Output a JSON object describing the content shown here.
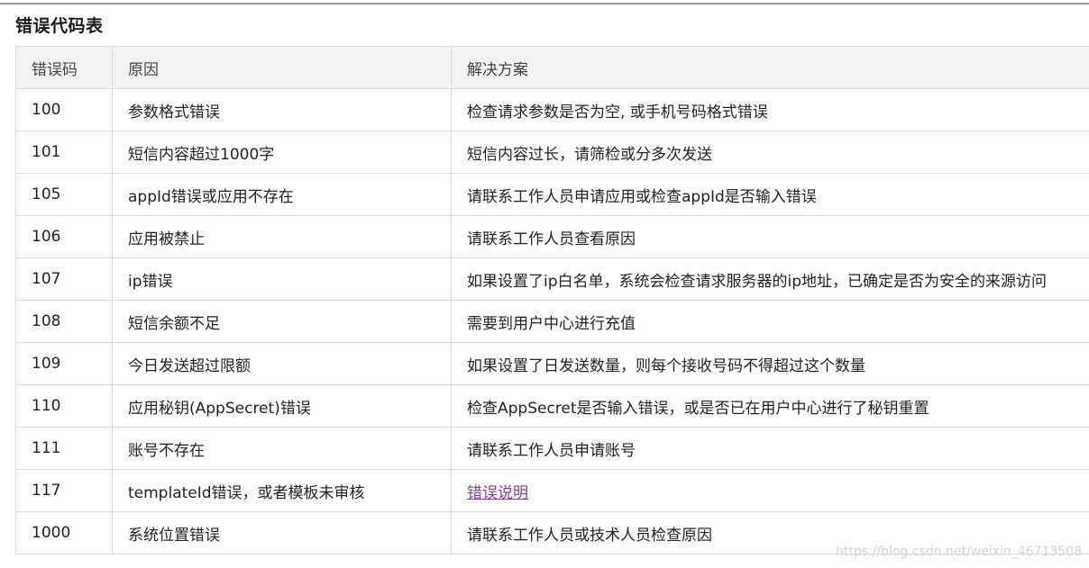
{
  "section_title": "错误代码表",
  "headers": [
    "错误码",
    "原因",
    "解决方案"
  ],
  "rows": [
    {
      "code": "100",
      "reason": "参数格式错误",
      "solution": "检查请求参数是否为空, 或手机号码格式错误"
    },
    {
      "code": "101",
      "reason": "短信内容超过1000字",
      "solution": "短信内容过长，请筛检或分多次发送"
    },
    {
      "code": "105",
      "reason": "appId错误或应用不存在",
      "solution": "请联系工作人员申请应用或检查appId是否输入错误"
    },
    {
      "code": "106",
      "reason": "应用被禁止",
      "solution": "请联系工作人员查看原因"
    },
    {
      "code": "107",
      "reason": "ip错误",
      "solution": "如果设置了ip白名单，系统会检查请求服务器的ip地址，已确定是否为安全的来源访问"
    },
    {
      "code": "108",
      "reason": "短信余额不足",
      "solution": "需要到用户中心进行充值"
    },
    {
      "code": "109",
      "reason": "今日发送超过限额",
      "solution": "如果设置了日发送数量，则每个接收号码不得超过这个数量"
    },
    {
      "code": "110",
      "reason": "应用秘钥(AppSecret)错误",
      "solution": "检查AppSecret是否输入错误，或是否已在用户中心进行了秘钥重置"
    },
    {
      "code": "111",
      "reason": "账号不存在",
      "solution": "请联系工作人员申请账号"
    },
    {
      "code": "117",
      "reason": "templateId错误，或者模板未审核",
      "solution": "错误说明",
      "solution_is_link": true
    },
    {
      "code": "1000",
      "reason": "系统位置错误",
      "solution": "请联系工作人员或技术人员检查原因"
    }
  ],
  "watermark": "https://blog.csdn.net/weixin_46713508"
}
